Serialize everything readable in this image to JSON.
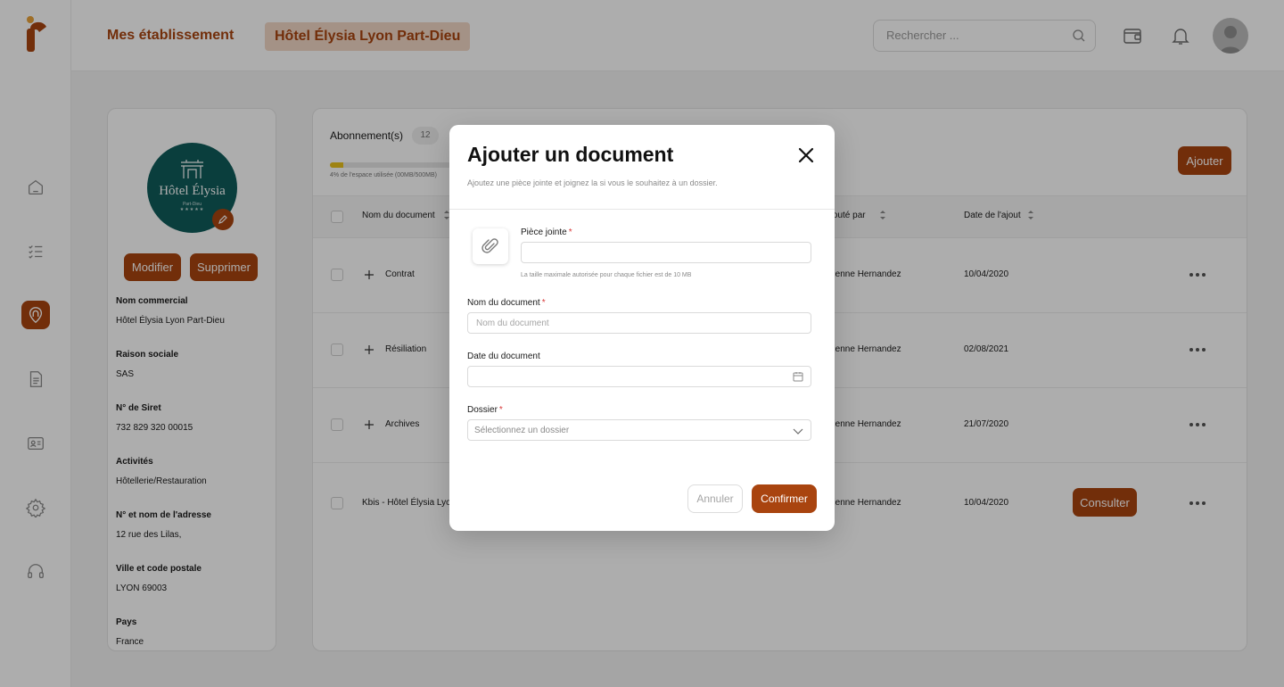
{
  "header": {
    "breadcrumb": [
      "Mes établissement",
      "Hôtel Élysia Lyon Part-Dieu"
    ],
    "search_placeholder": "Rechercher ..."
  },
  "profile": {
    "logo_name": "Hôtel Élysia",
    "logo_sub": "Part-Dieu",
    "logo_stars": "★★★★★",
    "modify_label": "Modifier",
    "delete_label": "Supprimer",
    "fields": [
      {
        "label": "Nom commercial",
        "value": "Hôtel Élysia Lyon Part-Dieu"
      },
      {
        "label": "Raison sociale",
        "value": "SAS"
      },
      {
        "label": "N° de Siret",
        "value": "732 829 320 00015"
      },
      {
        "label": "Activités",
        "value": "Hôtellerie/Restauration"
      },
      {
        "label": "N° et nom de l'adresse",
        "value": "12 rue des Lilas,"
      },
      {
        "label": "Ville et code postale",
        "value": "LYON  69003"
      },
      {
        "label": "Pays",
        "value": "France"
      }
    ]
  },
  "documents": {
    "subscriptions_label": "Abonnement(s)",
    "subscriptions_count": "12",
    "storage_used_fraction": 0.04,
    "storage_text": "4% de l'espace utilisée (00MB/500MB)",
    "add_label": "Ajouter",
    "columns": [
      "Nom du document",
      "Ajouté par",
      "Date de l'ajout"
    ],
    "rows": [
      {
        "name": "Contrat",
        "added_by": "Étienne Hernandez",
        "date": "10/04/2020"
      },
      {
        "name": "Résiliation",
        "added_by": "Étienne Hernandez",
        "date": "02/08/2021"
      },
      {
        "name": "Archives",
        "added_by": "Étienne Hernandez",
        "date": "21/07/2020"
      },
      {
        "name": "Kbis - Hôtel Élysia Lyon",
        "added_by": "Étienne Hernandez",
        "date": "10/04/2020"
      }
    ],
    "consult_label": "Consulter"
  },
  "modal": {
    "title": "Ajouter un document",
    "subtitle": "Ajoutez une pièce jointe et joignez la si vous le souhaitez à un dossier.",
    "attachment_label": "Pièce jointe",
    "attachment_hint": "La taille maximale autorisée pour chaque fichier est de 10 MB",
    "doc_name_label": "Nom du document",
    "doc_name_placeholder": "Nom du document",
    "doc_date_label": "Date du document",
    "folder_label": "Dossier",
    "folder_placeholder": "Sélectionnez un dossier",
    "required_mark": "*",
    "cancel_label": "Annuler",
    "confirm_label": "Confirmer"
  },
  "colors": {
    "accent": "#a9440f",
    "accent_light": "#f2d8c6",
    "hotel_logo_bg": "#0f5c5a",
    "progress": "#e9c21c"
  }
}
